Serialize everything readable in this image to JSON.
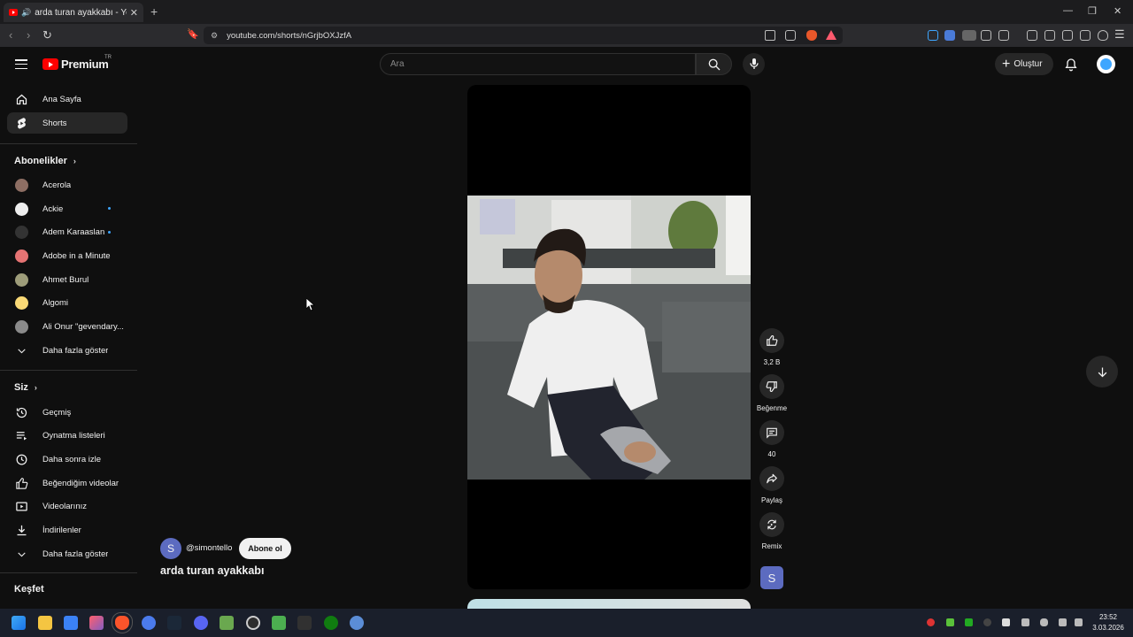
{
  "browser": {
    "tab_title": "arda turan ayakkabı - YouTube",
    "tab_close": "✕",
    "new_tab": "+",
    "url": "youtube.com/shorts/nGrjbOXJzfA"
  },
  "header": {
    "logo_text": "Premium",
    "logo_region": "TR",
    "search_placeholder": "Ara",
    "create_label": "Oluştur"
  },
  "sidebar": {
    "main": [
      {
        "label": "Ana Sayfa",
        "icon": "home-icon"
      },
      {
        "label": "Shorts",
        "icon": "shorts-icon"
      }
    ],
    "subscriptions_title": "Abonelikler",
    "subscriptions": [
      {
        "label": "Acerola",
        "color": "#8d6e63",
        "new": false
      },
      {
        "label": "Ackie",
        "color": "#eeeeee",
        "new": true
      },
      {
        "label": "Adem Karaaslan",
        "color": "#333333",
        "new": true
      },
      {
        "label": "Adobe in a Minute",
        "color": "#e57373",
        "new": false
      },
      {
        "label": "Ahmet Burul",
        "color": "#9e9d7a",
        "new": false
      },
      {
        "label": "Algomi",
        "color": "#f9d976",
        "new": false
      },
      {
        "label": "Ali Onur \"gevendary...",
        "color": "#8a8a8a",
        "new": false
      }
    ],
    "show_more_subs": "Daha fazla göster",
    "you_title": "Siz",
    "you_items": [
      {
        "label": "Geçmiş",
        "icon": "history-icon"
      },
      {
        "label": "Oynatma listeleri",
        "icon": "playlists-icon"
      },
      {
        "label": "Daha sonra izle",
        "icon": "watch-later-icon"
      },
      {
        "label": "Beğendiğim videolar",
        "icon": "liked-videos-icon"
      },
      {
        "label": "Videolarınız",
        "icon": "your-videos-icon"
      },
      {
        "label": "İndirilenler",
        "icon": "downloads-icon"
      }
    ],
    "show_more_you": "Daha fazla göster",
    "explore_title": "Keşfet"
  },
  "short": {
    "channel_initial": "S",
    "channel_handle": "@simontello",
    "subscribe_label": "Abone ol",
    "title": "arda turan ayakkabı"
  },
  "actions": {
    "like_count": "3,2 B",
    "dislike_label": "Beğenme",
    "comment_count": "40",
    "share_label": "Paylaş",
    "remix_label": "Remix",
    "remix_initial": "S"
  },
  "taskbar": {
    "time": "23:52",
    "date": "3.03.2026"
  }
}
